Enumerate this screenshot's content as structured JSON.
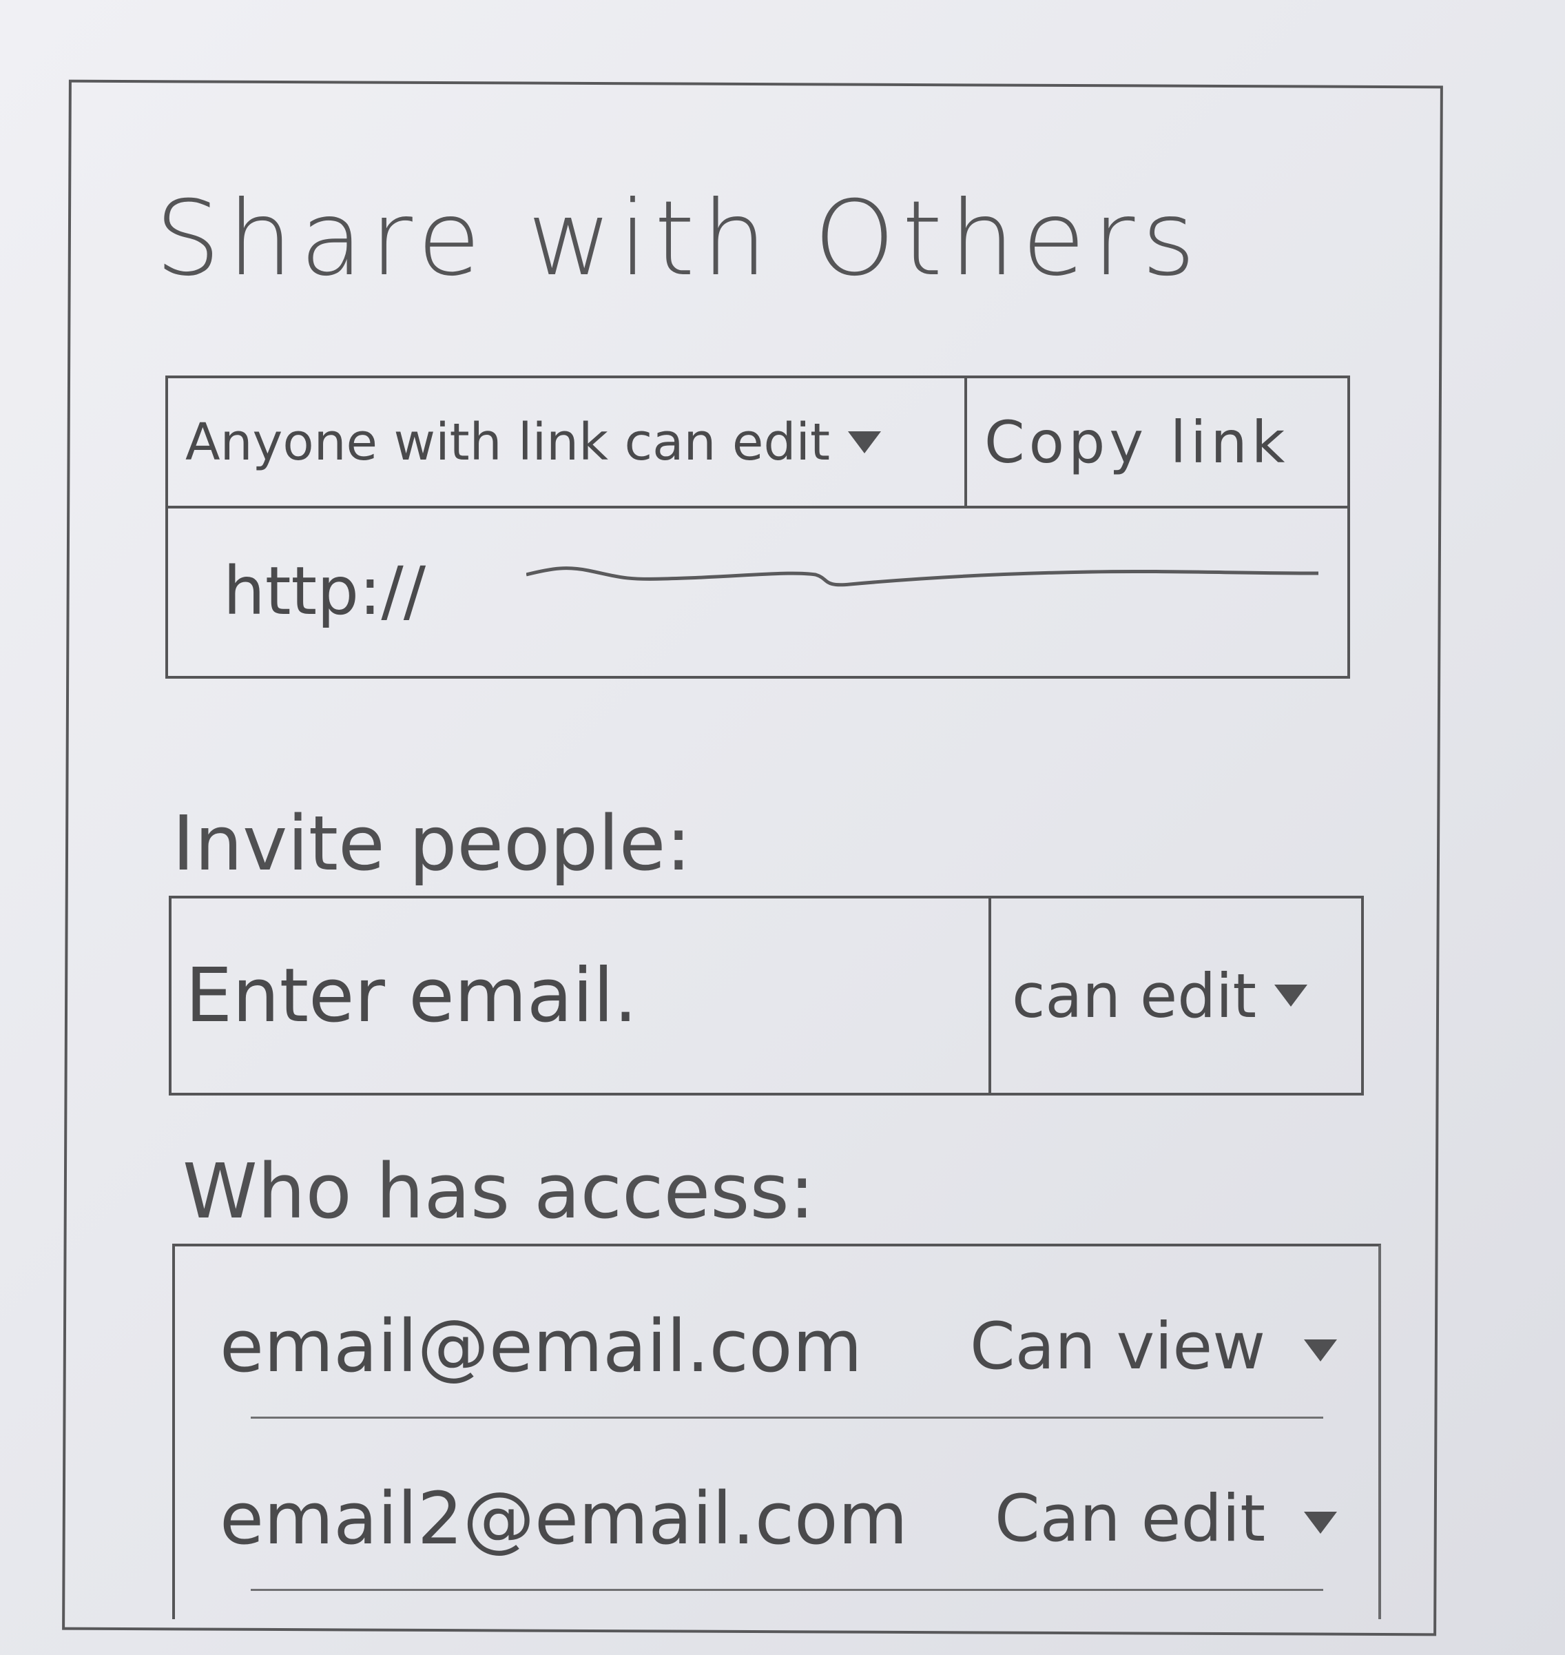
{
  "dialog": {
    "title": "Share with Others"
  },
  "link_sharing": {
    "access_option": "Anyone with link can edit",
    "copy_button": "Copy link",
    "url_prefix": "http://"
  },
  "invite": {
    "label": "Invite people:",
    "email_placeholder": "Enter email.",
    "permission": "can edit"
  },
  "access": {
    "label": "Who has access:",
    "rows": [
      {
        "email": "email@email.com",
        "permission": "Can view"
      },
      {
        "email": "email2@email.com",
        "permission": "Can edit"
      }
    ]
  },
  "icons": {
    "dropdown": "triangle-down-icon"
  }
}
